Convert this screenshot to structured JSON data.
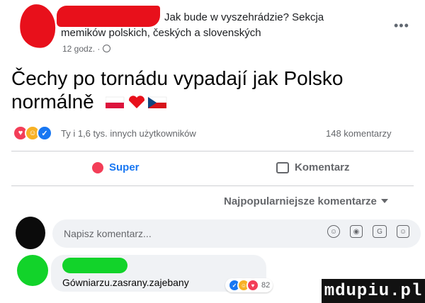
{
  "header": {
    "line1": "Jak bude w vyszehrádzie? Sekcja",
    "line2": "memików polskich, českých a slovenských",
    "time": "12 godz. ·"
  },
  "post": {
    "text": "Čechy po tornádu vypadají jak Polsko normálně"
  },
  "reactions": {
    "summary": "Ty i 1,6 tys. innych użytkowników",
    "comments_count": "148 komentarzy",
    "icons": [
      "love-icon",
      "haha-icon",
      "like-icon"
    ]
  },
  "actions": {
    "super_label": "Super",
    "comment_label": "Komentarz"
  },
  "sort": {
    "label": "Najpopularniejsze komentarze"
  },
  "composer": {
    "placeholder": "Napisz komentarz..."
  },
  "reply": {
    "text": "Gówniarzu.zasrany.zajebany",
    "reaction_count": "82"
  },
  "watermark": {
    "text": "mdupiu.pl"
  },
  "colors": {
    "accent": "#1877f2",
    "redaction_red": "#e8101b",
    "redaction_green": "#12d32a",
    "love": "#f33e58",
    "haha": "#f7b125"
  }
}
